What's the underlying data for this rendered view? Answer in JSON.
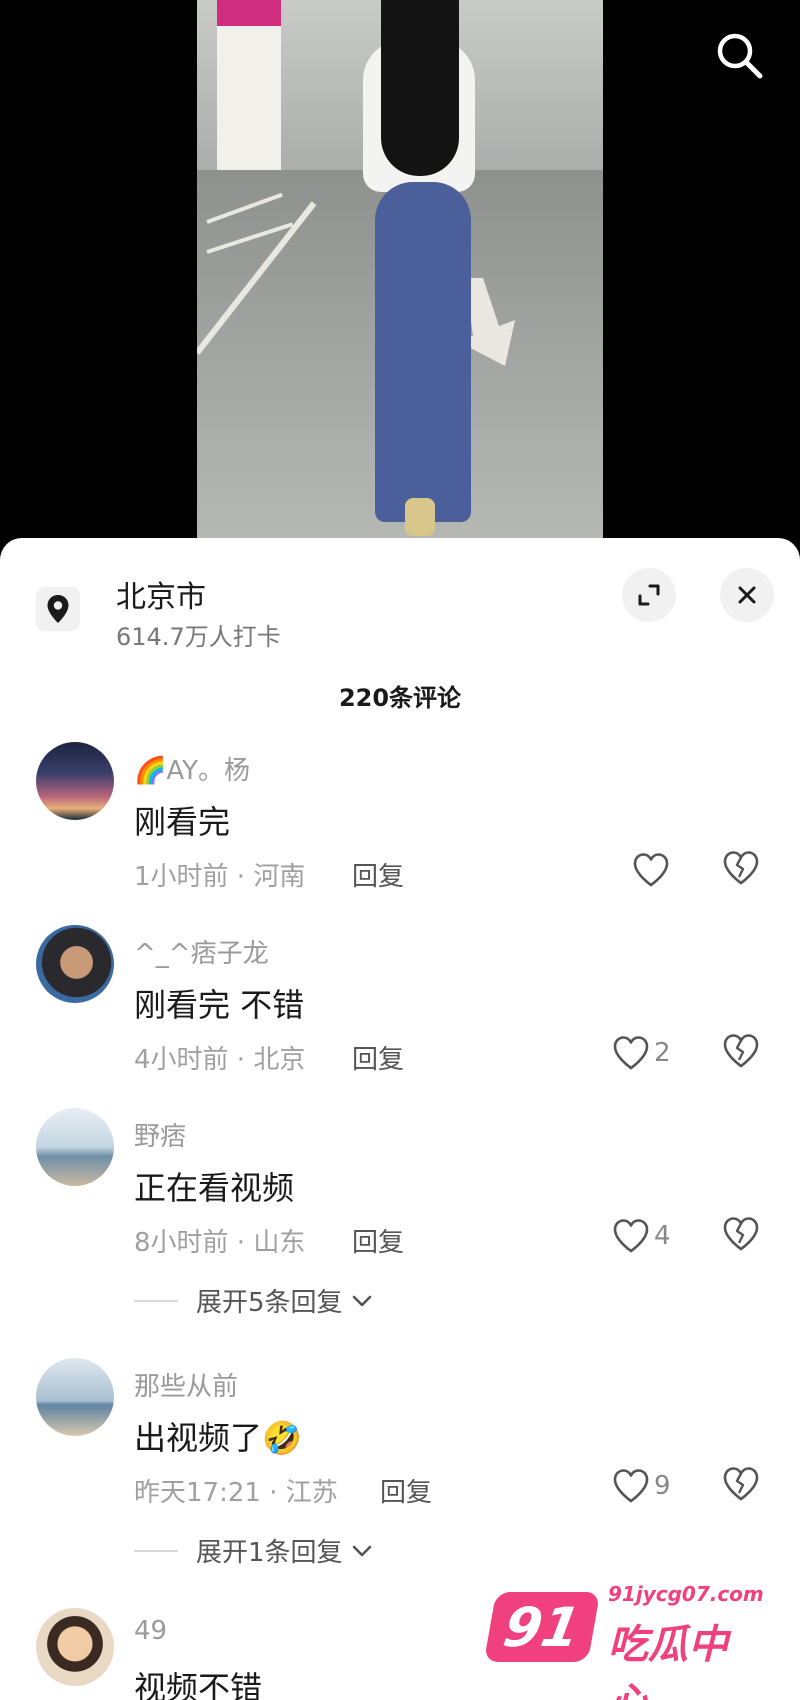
{
  "location": {
    "name": "北京市",
    "checkins": "614.7万人打卡"
  },
  "comments_count": "220条评论",
  "reply_label": "回复",
  "comments": [
    {
      "user": "🌈AY。杨",
      "text": "刚看完",
      "meta": "1小时前 · 河南",
      "likes": ""
    },
    {
      "user": "^_^痞子龙",
      "text": "刚看完 不错",
      "meta": "4小时前 · 北京",
      "likes": "2"
    },
    {
      "user": "野痞",
      "text": "正在看视频",
      "meta": "8小时前 · 山东",
      "likes": "4",
      "expand": "展开5条回复"
    },
    {
      "user": "那些从前",
      "text": "出视频了🤣",
      "meta": "昨天17:21 · 江苏",
      "likes": "9",
      "expand": "展开1条回复"
    },
    {
      "user": "49",
      "text": "视频不错"
    }
  ],
  "watermark": {
    "badge": "91",
    "url": "91jycg07.com",
    "name": "吃瓜中心"
  },
  "icons": {
    "search": "search-icon",
    "pin": "location-pin-icon",
    "expand": "expand-icon",
    "close": "close-icon",
    "like": "heart-icon",
    "dislike": "broken-heart-icon",
    "chevron": "chevron-down-icon"
  }
}
